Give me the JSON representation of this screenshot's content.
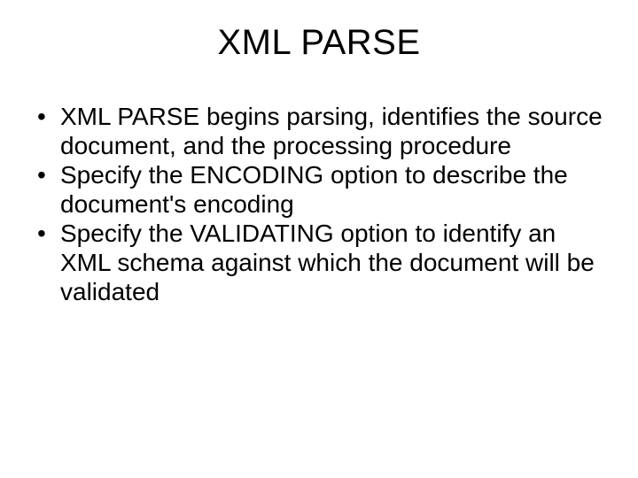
{
  "slide": {
    "title": "XML PARSE",
    "bullets": [
      "XML PARSE begins parsing, identifies the source document, and the processing procedure",
      "Specify the ENCODING option to describe the document's encoding",
      "Specify the VALIDATING option to identify an XML schema against which the document will be validated"
    ]
  }
}
